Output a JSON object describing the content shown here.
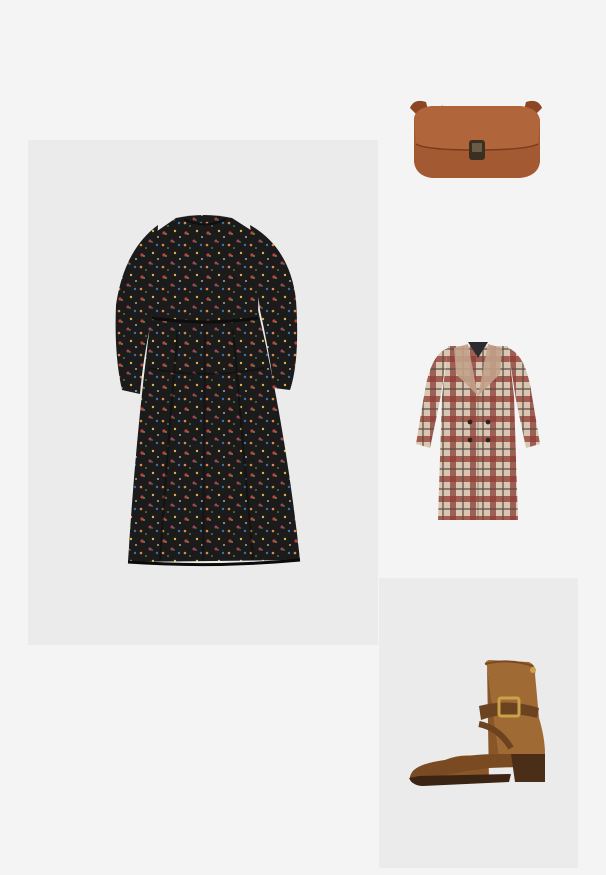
{
  "outfit": {
    "items": [
      {
        "product": "floral-print-dress",
        "image_color": "#1c1c1c"
      },
      {
        "product": "brown-leather-crossbody-bag",
        "image_color": "#a0532b"
      },
      {
        "product": "checked-wool-coat",
        "image_color": "#c9a48e"
      },
      {
        "product": "brown-buckle-ankle-boot",
        "image_color": "#9a6530"
      }
    ]
  }
}
